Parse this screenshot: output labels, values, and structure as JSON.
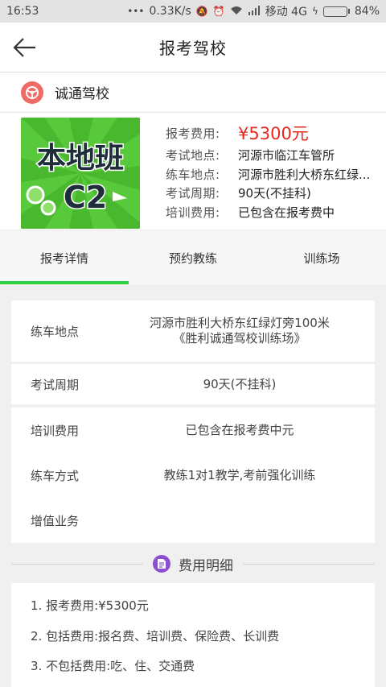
{
  "status_bar": {
    "time": "16:53",
    "network_speed": "0.33K/s",
    "carrier": "移动 4G",
    "battery_percent": "84%",
    "battery_level": 0.84
  },
  "header": {
    "title": "报考驾校"
  },
  "school": {
    "name": "诚通驾校"
  },
  "summary": {
    "image_text": "本地班 C2",
    "fields": [
      {
        "label": "报考费用:",
        "value": "¥5300元"
      },
      {
        "label": "考试地点:",
        "value": "河源市临江车管所"
      },
      {
        "label": "练车地点:",
        "value": "河源市胜利大桥东红绿..."
      },
      {
        "label": "考试周期:",
        "value": "90天(不挂科)"
      },
      {
        "label": "培训费用:",
        "value": "已包含在报考费中"
      }
    ]
  },
  "tabs": [
    {
      "label": "报考详情",
      "active": true
    },
    {
      "label": "预约教练",
      "active": false
    },
    {
      "label": "训练场",
      "active": false
    }
  ],
  "details": [
    {
      "label": "练车地点",
      "value_line1": "河源市胜利大桥东红绿灯旁100米",
      "value_line2": "《胜利诚通驾校训练场》"
    },
    {
      "label": "考试周期",
      "value_line1": "90天(不挂科)"
    },
    {
      "label": "培训费用",
      "value_line1": "已包含在报考费中元"
    },
    {
      "label": "练车方式",
      "value_line1": "教练1对1教学,考前强化训练"
    },
    {
      "label": "增值业务",
      "value_line1": ""
    }
  ],
  "fees": {
    "title": "费用明细",
    "items": [
      "1. 报考费用:¥5300元",
      "2. 包括费用:报名费、培训费、保险费、长训费",
      "3. 不包括费用:吃、住、交通费"
    ]
  },
  "colors": {
    "accent": "#2fcf40",
    "price": "#e8271e",
    "school_icon": "#f06a66",
    "fee_icon": "#8b4fd1"
  }
}
